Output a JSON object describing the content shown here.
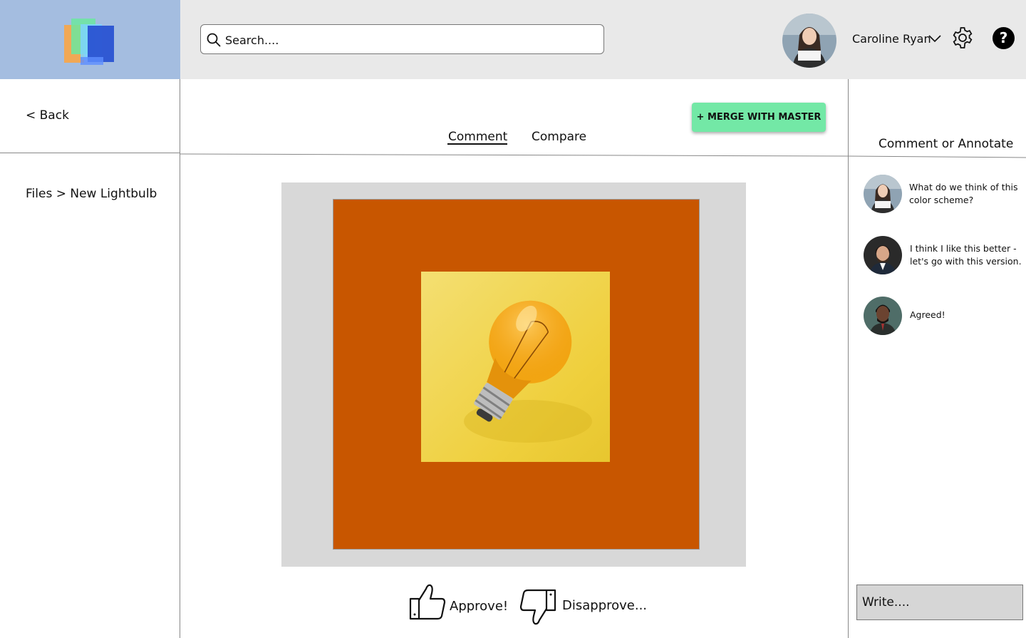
{
  "header": {
    "search_placeholder": "Search....",
    "user_name": "Caroline Ryan",
    "help_label": "?"
  },
  "sidebar": {
    "back_label": "< Back",
    "breadcrumb": "Files >  New Lightbulb"
  },
  "tabs": [
    {
      "label": "Comment",
      "active": true
    },
    {
      "label": "Compare",
      "active": false
    }
  ],
  "merge_button_label": "+ MERGE WITH MASTER",
  "artboard": {
    "background_color": "#c85600",
    "image": "lightbulb-photo"
  },
  "review": {
    "approve_label": "Approve!",
    "disapprove_label": "Disapprove..."
  },
  "comments_panel": {
    "title": "Comment or Annotate",
    "comments": [
      {
        "text": "What do we think of this color scheme?"
      },
      {
        "text": "I think I like this better - let's go with this version."
      },
      {
        "text": "Agreed!"
      }
    ],
    "write_placeholder": "Write...."
  },
  "colors": {
    "accent_merge": "#73e8a6",
    "logo_panel": "#a4bde0",
    "topbar": "#e9e9e9"
  }
}
